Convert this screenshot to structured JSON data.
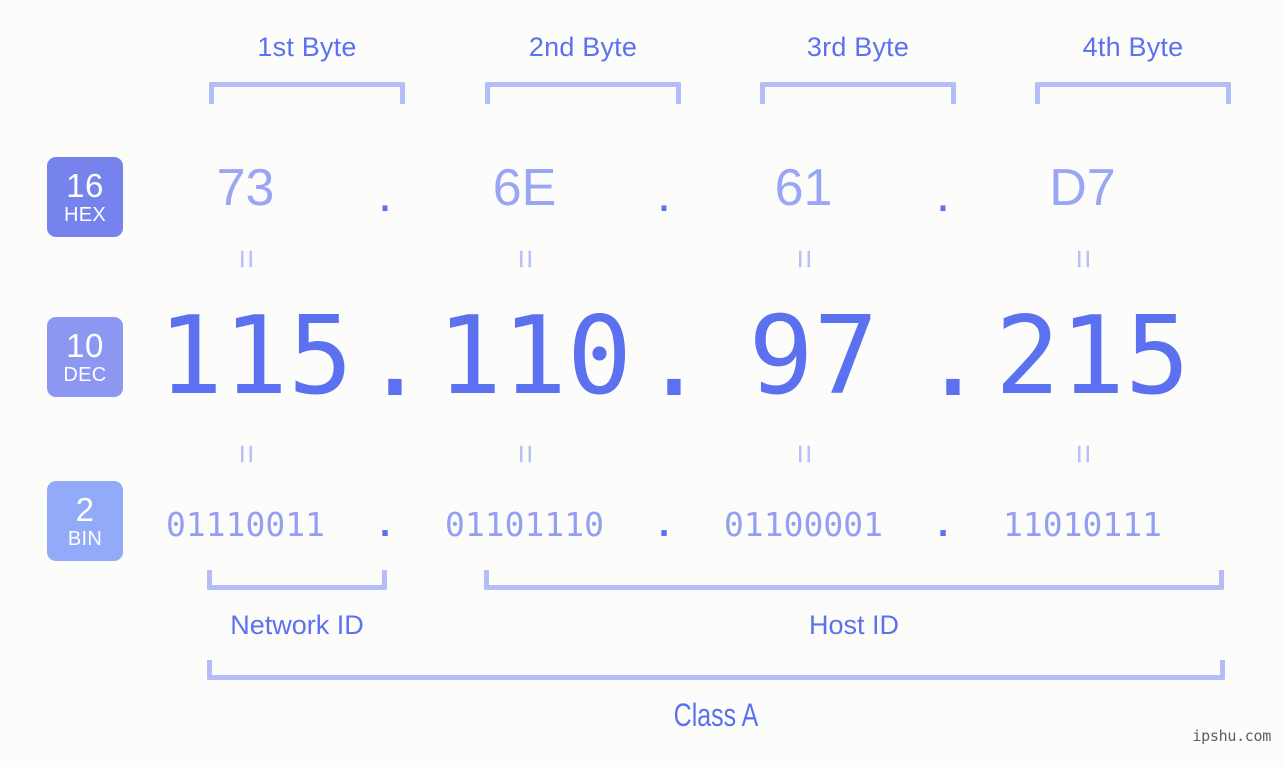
{
  "meta": {
    "background_color": "#fcfdfa",
    "accent_color": "#5b71ef",
    "accent_light": "#9aa6f5",
    "bracket_color": "#b5bdf9"
  },
  "byte_headers": [
    {
      "label": "1st Byte"
    },
    {
      "label": "2nd Byte"
    },
    {
      "label": "3rd Byte"
    },
    {
      "label": "4th Byte"
    }
  ],
  "bases": [
    {
      "number": "16",
      "abbr": "HEX",
      "color": "#7683ec"
    },
    {
      "number": "10",
      "abbr": "DEC",
      "color": "#8b97f1"
    },
    {
      "number": "2",
      "abbr": "BIN",
      "color": "#92aaf7"
    }
  ],
  "separator": ".",
  "equals": "=",
  "rows": {
    "hex": {
      "octets": [
        "73",
        "6E",
        "61",
        "D7"
      ]
    },
    "dec": {
      "octets": [
        "115",
        "110",
        "97",
        "215"
      ]
    },
    "bin": {
      "octets": [
        "01110011",
        "01101110",
        "01100001",
        "11010111"
      ]
    }
  },
  "sections": [
    {
      "label": "Network ID"
    },
    {
      "label": "Host ID"
    }
  ],
  "class": {
    "label": "Class A"
  },
  "watermark": {
    "text": "ipshu.com"
  }
}
